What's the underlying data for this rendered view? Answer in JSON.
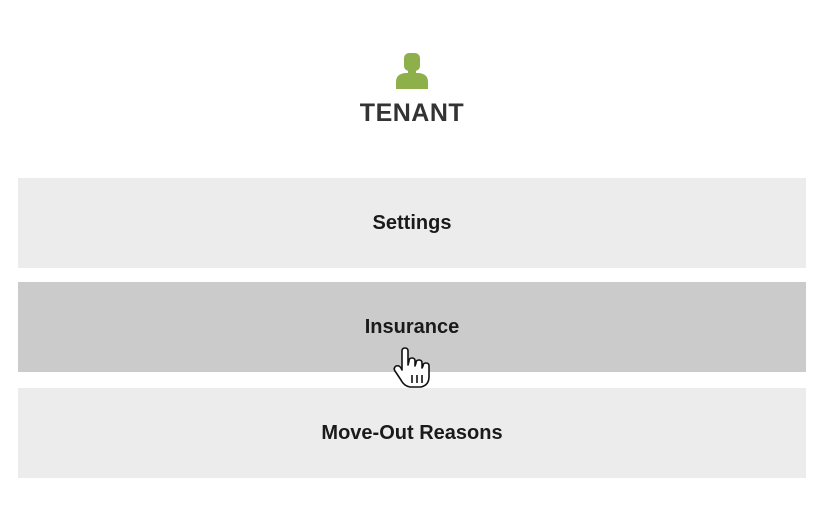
{
  "section": {
    "title": "TENANT",
    "icon": "user-icon",
    "icon_color": "#8db04a"
  },
  "menu": {
    "items": [
      {
        "label": "Settings",
        "state": "default"
      },
      {
        "label": "Insurance",
        "state": "hover"
      },
      {
        "label": "Move-Out Reasons",
        "state": "default"
      }
    ]
  },
  "colors": {
    "item_bg": "#ececec",
    "item_hover_bg": "#cbcbcb",
    "title_text": "#333333"
  },
  "cursor": "hand-pointer-icon"
}
